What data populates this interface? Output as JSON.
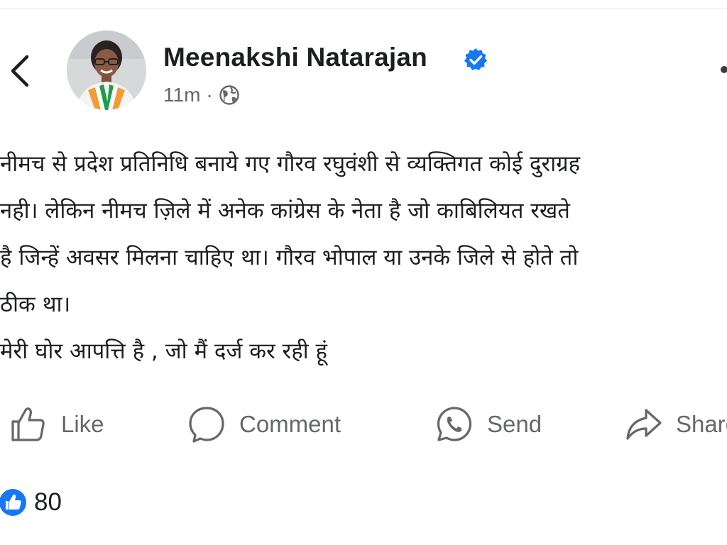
{
  "post": {
    "author": "Meenakshi Natarajan",
    "verified_icon": "verified-badge-icon",
    "time": "11m",
    "separator": "·",
    "audience_icon": "globe-icon",
    "text_lines": [
      "नीमच से प्रदेश प्रतिनिधि बनाये गए गौरव रघुवंशी से व्यक्तिगत कोई दुराग्रह",
      "नही। लेकिन नीमच ज़िले में अनेक कांग्रेस के नेता है जो काबिलियत रखते",
      "है जिन्हें अवसर मिलना चाहिए था। गौरव भोपाल या उनके जिले से होते तो",
      "ठीक था।",
      "मेरी घोर आपत्ति है , जो मैं दर्ज कर रही हूं"
    ]
  },
  "actions": {
    "like": "Like",
    "comment": "Comment",
    "send": "Send",
    "share": "Share"
  },
  "reactions": {
    "count": "80"
  },
  "colors": {
    "accent": "#1877f2",
    "text": "#1c1e21",
    "secondary": "#65676b"
  }
}
